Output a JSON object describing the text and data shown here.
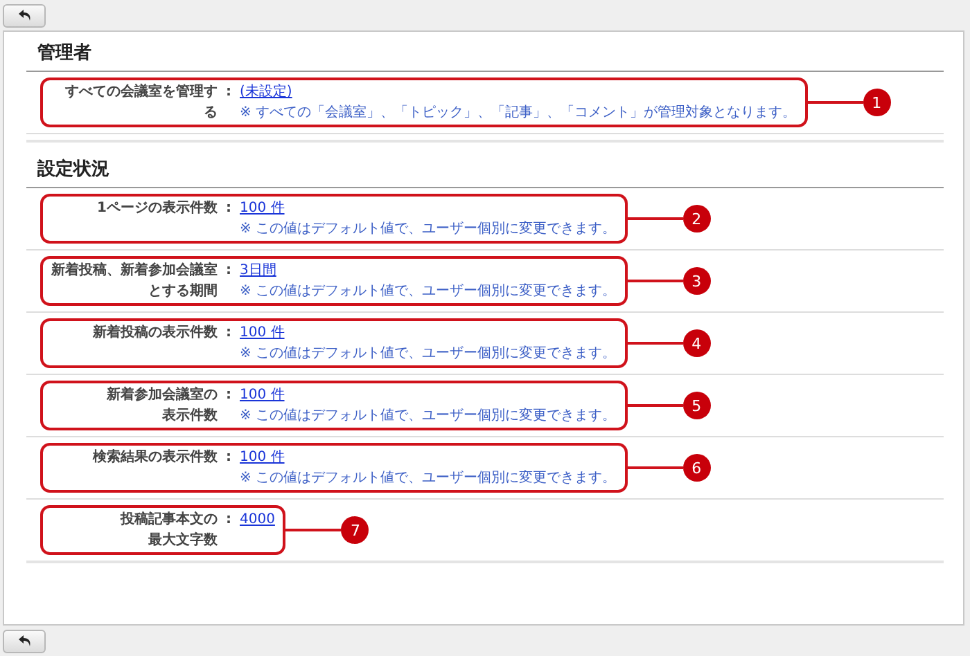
{
  "sections": [
    {
      "title": "管理者",
      "rows": [
        {
          "label_lines": [
            "すべての会議室を管理す",
            "る"
          ],
          "separator": ":",
          "value": "(未設定)",
          "note": "※ すべての「会議室」、「トピック」、「記事」、「コメント」が管理対象となります。",
          "callout": "1"
        }
      ]
    },
    {
      "title": "設定状況",
      "rows": [
        {
          "label_lines": [
            "1ページの表示件数"
          ],
          "separator": ":",
          "value": "100 件",
          "note": "※ この値はデフォルト値で、ユーザー個別に変更できます。",
          "callout": "2"
        },
        {
          "label_lines": [
            "新着投稿、新着参加会議室",
            "とする期間"
          ],
          "separator": ":",
          "value": "3日間",
          "note": "※ この値はデフォルト値で、ユーザー個別に変更できます。",
          "callout": "3"
        },
        {
          "label_lines": [
            "新着投稿の表示件数"
          ],
          "separator": ":",
          "value": "100 件",
          "note": "※ この値はデフォルト値で、ユーザー個別に変更できます。",
          "callout": "4"
        },
        {
          "label_lines": [
            "新着参加会議室の",
            "表示件数"
          ],
          "separator": ":",
          "value": "100 件",
          "note": "※ この値はデフォルト値で、ユーザー個別に変更できます。",
          "callout": "5"
        },
        {
          "label_lines": [
            "検索結果の表示件数"
          ],
          "separator": ":",
          "value": "100 件",
          "note": "※ この値はデフォルト値で、ユーザー個別に変更できます。",
          "callout": "6"
        },
        {
          "label_lines": [
            "投稿記事本文の",
            "最大文字数"
          ],
          "separator": ":",
          "value": "4000",
          "callout": "7"
        }
      ]
    }
  ]
}
